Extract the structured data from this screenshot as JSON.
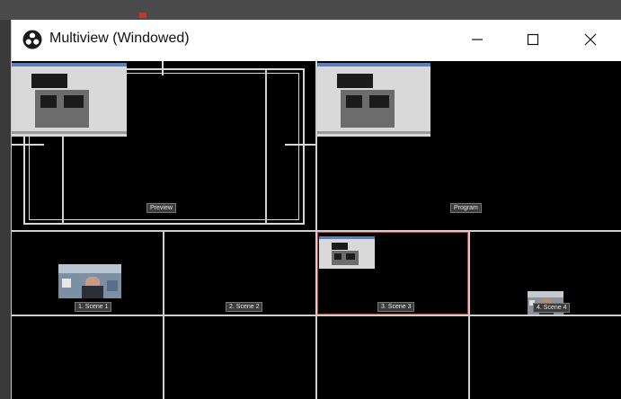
{
  "window": {
    "title": "Multiview (Windowed)",
    "controls": {
      "minimize": "minimize",
      "maximize": "maximize",
      "close": "close"
    },
    "app_icon": "obs-icon"
  },
  "multiview": {
    "preview_label": "Preview",
    "program_label": "Program",
    "scenes": [
      {
        "label": "1. Scene 1"
      },
      {
        "label": "2. Scene 2"
      },
      {
        "label": "3. Scene 3"
      },
      {
        "label": "4. Scene 4"
      }
    ]
  },
  "colors": {
    "selected_border": "#d23a3a",
    "grid_line": "#cfcfcf",
    "background": "#000000"
  }
}
